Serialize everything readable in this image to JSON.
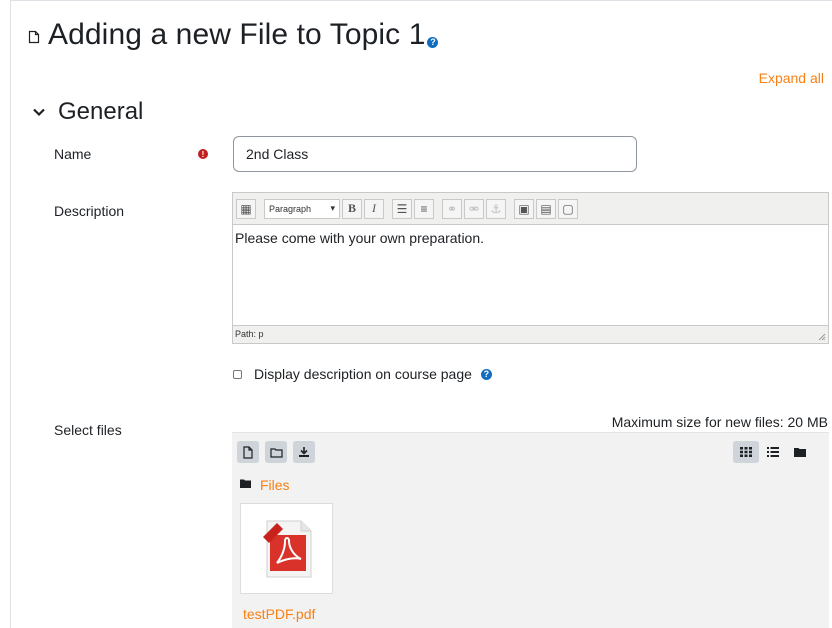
{
  "page": {
    "title": "Adding a new File to Topic 1",
    "expand_all": "Expand all"
  },
  "section": {
    "title": "General"
  },
  "form": {
    "name_label": "Name",
    "name_value": "2nd Class",
    "description_label": "Description",
    "editor": {
      "format_select": "Paragraph",
      "content": "Please come with your own preparation.",
      "path": "Path: p"
    },
    "display_description_label": "Display description on course page",
    "select_files_label": "Select files",
    "max_size": "Maximum size for new files: 20 MB",
    "files_breadcrumb": "Files",
    "file": {
      "name": "testPDF.pdf",
      "icon": "pdf-icon"
    }
  },
  "colors": {
    "link": "#f98012",
    "help": "#0f6cbf",
    "required": "#c31e1e"
  }
}
